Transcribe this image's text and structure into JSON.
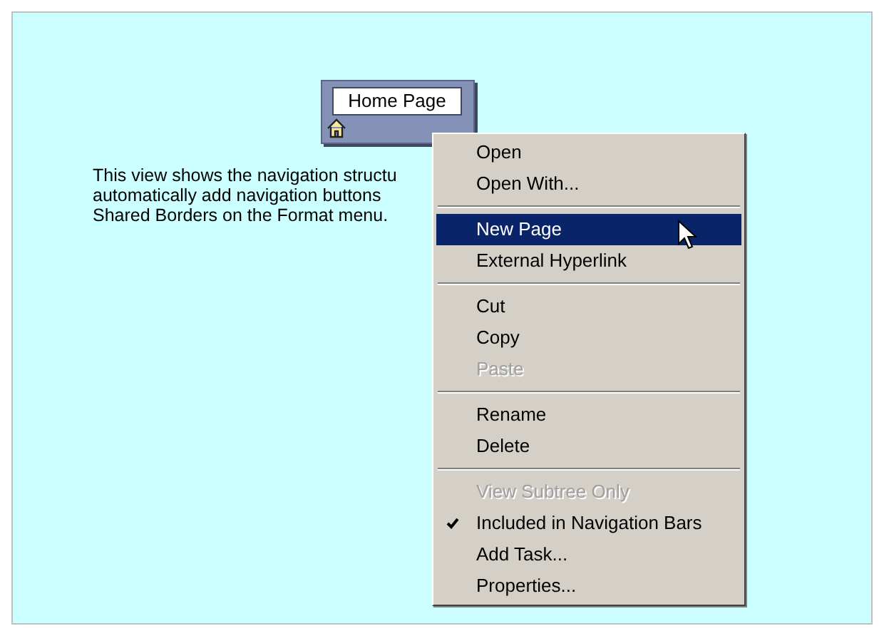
{
  "node": {
    "label": "Home Page"
  },
  "description": [
    "This view shows the navigation structu",
    "automatically add navigation buttons",
    "Shared Borders on the Format menu."
  ],
  "context_menu": {
    "groups": [
      [
        {
          "label": "Open",
          "disabled": false,
          "checked": false,
          "selected": false
        },
        {
          "label": "Open With...",
          "disabled": false,
          "checked": false,
          "selected": false
        }
      ],
      [
        {
          "label": "New Page",
          "disabled": false,
          "checked": false,
          "selected": true
        },
        {
          "label": "External Hyperlink",
          "disabled": false,
          "checked": false,
          "selected": false
        }
      ],
      [
        {
          "label": "Cut",
          "disabled": false,
          "checked": false,
          "selected": false
        },
        {
          "label": "Copy",
          "disabled": false,
          "checked": false,
          "selected": false
        },
        {
          "label": "Paste",
          "disabled": true,
          "checked": false,
          "selected": false
        }
      ],
      [
        {
          "label": "Rename",
          "disabled": false,
          "checked": false,
          "selected": false
        },
        {
          "label": "Delete",
          "disabled": false,
          "checked": false,
          "selected": false
        }
      ],
      [
        {
          "label": "View Subtree Only",
          "disabled": true,
          "checked": false,
          "selected": false
        },
        {
          "label": "Included in Navigation Bars",
          "disabled": false,
          "checked": true,
          "selected": false
        },
        {
          "label": "Add Task...",
          "disabled": false,
          "checked": false,
          "selected": false
        },
        {
          "label": "Properties...",
          "disabled": false,
          "checked": false,
          "selected": false
        }
      ]
    ]
  }
}
